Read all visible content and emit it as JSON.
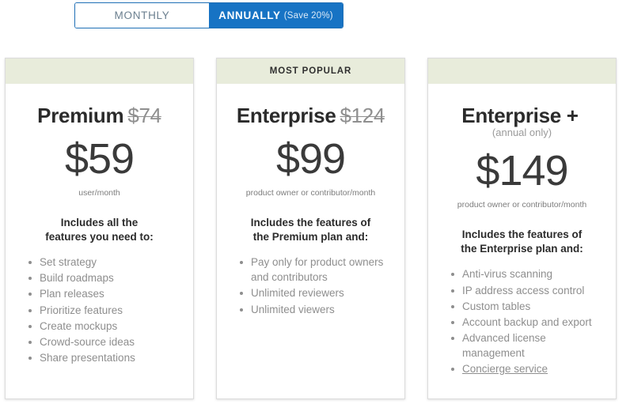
{
  "billing_toggle": {
    "monthly_label": "MONTHLY",
    "annually_label": "ANNUALLY",
    "annually_save": "(Save 20%)",
    "selected": "ANNUALLY",
    "active_color": "#1773c4",
    "inactive_color": "#6b7f8f"
  },
  "band_color": "#e8ecdb",
  "plans": [
    {
      "badge": "",
      "name": "Premium",
      "old_price": "$74",
      "subtitle": "",
      "price": "$59",
      "price_note": "user/month",
      "features_heading_line1": "Includes all the",
      "features_heading_line2": "features you need to:",
      "features": [
        "Set strategy",
        "Build roadmaps",
        "Plan releases",
        "Prioritize features",
        "Create mockups",
        "Crowd-source ideas",
        "Share presentations"
      ],
      "link_features": []
    },
    {
      "badge": "MOST POPULAR",
      "name": "Enterprise",
      "old_price": "$124",
      "subtitle": "",
      "price": "$99",
      "price_note": "product owner or contributor/month",
      "features_heading_line1": "Includes the features of",
      "features_heading_line2": "the Premium plan and:",
      "features": [
        "Pay only for product owners and contributors",
        "Unlimited reviewers",
        "Unlimited viewers"
      ],
      "link_features": []
    },
    {
      "badge": "",
      "name": "Enterprise +",
      "old_price": "",
      "subtitle": "(annual only)",
      "price": "$149",
      "price_note": "product owner or contributor/month",
      "features_heading_line1": "Includes the features of",
      "features_heading_line2": "the Enterprise plan and:",
      "features": [
        "Anti-virus scanning",
        "IP address access control",
        "Custom tables",
        "Account backup and export",
        "Advanced license management",
        "Concierge service"
      ],
      "link_features": [
        "Concierge service"
      ]
    }
  ]
}
